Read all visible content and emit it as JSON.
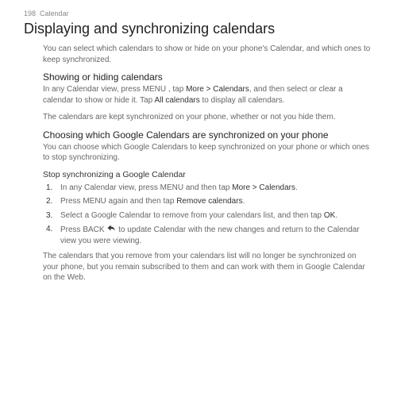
{
  "header": {
    "page_number": "198",
    "section": "Calendar"
  },
  "title": "Displaying and synchronizing calendars",
  "intro": "You can select which calendars to show or hide on your phone's Calendar, and which ones to keep synchronized.",
  "section1": {
    "heading": "Showing or hiding calendars",
    "p1_a": "In any Calendar view, press MENU , tap ",
    "p1_b": "More > Calendars",
    "p1_c": ", and then select or clear a calendar to show or hide it. Tap ",
    "p1_d": "All calendars",
    "p1_e": " to display all calendars.",
    "p2": "The calendars are kept synchronized on your phone, whether or not you hide them."
  },
  "section2": {
    "heading": "Choosing which Google Calendars are synchronized on your phone",
    "p1": "You can choose which Google Calendars to keep synchronized on your phone or which ones to stop synchronizing.",
    "sub_heading": "Stop synchronizing a Google Calendar",
    "steps": [
      {
        "n": "1.",
        "a": "In any Calendar view, press MENU and then tap ",
        "b": "More > Calendars",
        "c": "."
      },
      {
        "n": "2.",
        "a": "Press MENU again and then tap ",
        "b": "Remove calendars",
        "c": "."
      },
      {
        "n": "3.",
        "a": "Select a Google Calendar to remove from your calendars list, and then tap ",
        "b": "OK",
        "c": "."
      },
      {
        "n": "4.",
        "a": "Press BACK ",
        "icon": true,
        "c": " to update Calendar with the new changes and return to the Calendar view you were viewing."
      }
    ],
    "closing": "The calendars that you remove from your calendars list will no longer be synchronized on your phone, but you remain subscribed to them and can work with them in Google Calendar on the Web."
  }
}
